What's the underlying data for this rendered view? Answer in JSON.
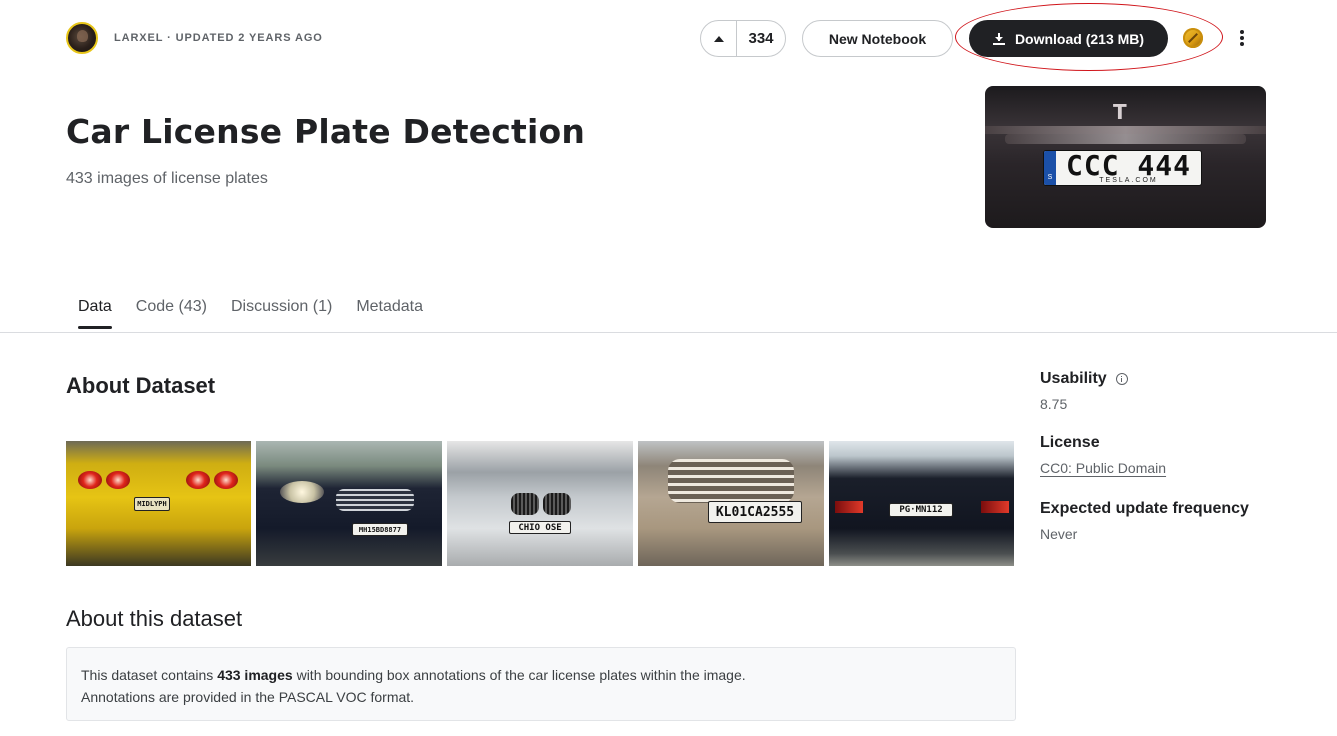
{
  "owner": {
    "meta": "LARXEL · UPDATED 2 YEARS AGO"
  },
  "actions": {
    "vote_count": "334",
    "new_notebook_label": "New Notebook",
    "download_label": "Download (213 MB)"
  },
  "dataset": {
    "title": "Car License Plate Detection",
    "subtitle": "433 images of license plates",
    "cover_plate_text": "CCC 444",
    "cover_plate_subtext": "TESLA.COM",
    "cover_plate_country": "S"
  },
  "tabs": [
    {
      "label": "Data",
      "active": true
    },
    {
      "label": "Code (43)",
      "active": false
    },
    {
      "label": "Discussion (1)",
      "active": false
    },
    {
      "label": "Metadata",
      "active": false
    }
  ],
  "about": {
    "heading": "About Dataset",
    "gallery_plates": [
      "MIDLYPH",
      "MH15BD8877",
      "CHIO OSE",
      "KL01CA2555",
      "PG·MN112"
    ],
    "section_heading": "About this dataset",
    "description_prefix": "This dataset contains ",
    "description_bold": "433 images",
    "description_suffix": " with bounding box annotations of the car license plates within the image.",
    "description_line2": "Annotations are provided in the PASCAL VOC format."
  },
  "sidebar": {
    "usability_label": "Usability",
    "usability_value": "8.75",
    "license_label": "License",
    "license_value": "CC0: Public Domain",
    "update_label": "Expected update frequency",
    "update_value": "Never"
  },
  "colors": {
    "primary_button": "#202124",
    "annotation_ring": "#d0151b"
  }
}
